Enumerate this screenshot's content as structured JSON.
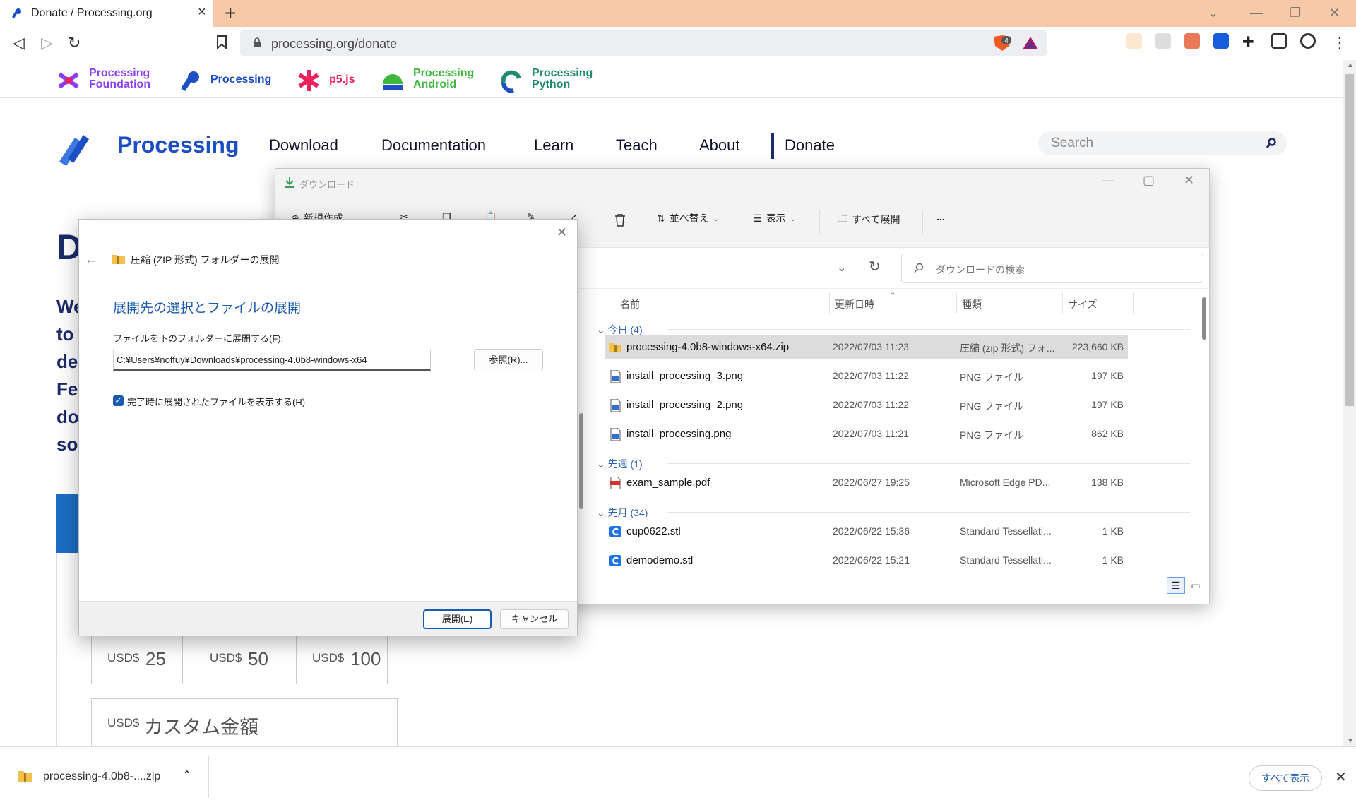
{
  "browser": {
    "tab_title": "Donate / Processing.org",
    "url": "processing.org/donate",
    "brave_badge": "4"
  },
  "sites_bar": [
    {
      "name_line1": "Processing",
      "name_line2": "Foundation",
      "color": "#8a3ffc"
    },
    {
      "name_line1": "Processing",
      "name_line2": "",
      "color": "#1c4fc4"
    },
    {
      "name_line1": "p5.js",
      "name_line2": "",
      "color": "#ed225d"
    },
    {
      "name_line1": "Processing",
      "name_line2": "Android",
      "color": "#3fb73f"
    },
    {
      "name_line1": "Processing",
      "name_line2": "Python",
      "color": "#1f8a70"
    }
  ],
  "site": {
    "logo_text": "Processing",
    "nav": [
      "Download",
      "Documentation",
      "Learn",
      "Teach",
      "About",
      "Donate"
    ],
    "search_placeholder": "Search",
    "heading_fragment": "D",
    "intro_fragments": [
      "We",
      "to",
      "de",
      "Fel",
      "do",
      "sou"
    ],
    "amounts": [
      {
        "currency": "USD$",
        "value": "25"
      },
      {
        "currency": "USD$",
        "value": "50"
      },
      {
        "currency": "USD$",
        "value": "100"
      }
    ],
    "custom_amount": {
      "currency": "USD$",
      "label": "カスタム金額"
    }
  },
  "explorer": {
    "title": "ダウンロード",
    "commands": {
      "new": "新規作成",
      "sort": "並べ替え",
      "view": "表示",
      "extract_all": "すべて展開",
      "more": "..."
    },
    "search_placeholder": "ダウンロードの検索",
    "columns": [
      "名前",
      "更新日時",
      "種類",
      "サイズ"
    ],
    "groups": [
      {
        "label": "今日 (4)",
        "files": [
          {
            "name": "processing-4.0b8-windows-x64.zip",
            "date": "2022/07/03 11:23",
            "type": "圧縮 (zip 形式) フォ...",
            "size": "223,660 KB",
            "icon": "zip-folder-icon",
            "selected": true
          },
          {
            "name": "install_processing_3.png",
            "date": "2022/07/03 11:22",
            "type": "PNG ファイル",
            "size": "197 KB",
            "icon": "png-file-icon"
          },
          {
            "name": "install_processing_2.png",
            "date": "2022/07/03 11:22",
            "type": "PNG ファイル",
            "size": "197 KB",
            "icon": "png-file-icon"
          },
          {
            "name": "install_processing.png",
            "date": "2022/07/03 11:21",
            "type": "PNG ファイル",
            "size": "862 KB",
            "icon": "png-file-icon"
          }
        ]
      },
      {
        "label": "先週 (1)",
        "files": [
          {
            "name": "exam_sample.pdf",
            "date": "2022/06/27 19:25",
            "type": "Microsoft Edge PD...",
            "size": "138 KB",
            "icon": "pdf-file-icon"
          }
        ]
      },
      {
        "label": "先月 (34)",
        "files": [
          {
            "name": "cup0622.stl",
            "date": "2022/06/22 15:36",
            "type": "Standard Tessellati...",
            "size": "1 KB",
            "icon": "stl-file-icon"
          },
          {
            "name": "demodemo.stl",
            "date": "2022/06/22 15:21",
            "type": "Standard Tessellati...",
            "size": "1 KB",
            "icon": "stl-file-icon"
          }
        ]
      }
    ]
  },
  "dialog": {
    "title": "圧縮 (ZIP 形式) フォルダーの展開",
    "heading": "展開先の選択とファイルの展開",
    "field_label": "ファイルを下のフォルダーに展開する(F):",
    "path": "C:¥Users¥noffuy¥Downloads¥processing-4.0b8-windows-x64",
    "browse": "参照(R)...",
    "show_files": "完了時に展開されたファイルを表示する(H)",
    "extract": "展開(E)",
    "cancel": "キャンセル"
  },
  "download_shelf": {
    "file": "processing-4.0b8-....zip",
    "show_all": "すべて表示"
  },
  "colors": {
    "tabbar": "#f7c9a6",
    "processing_blue": "#1c4fc4",
    "nav_dark": "#11132e",
    "windows_accent": "#1a5bb0"
  }
}
